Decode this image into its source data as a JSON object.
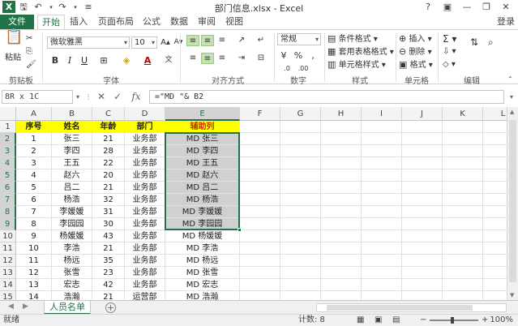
{
  "titlebar": {
    "title": "部门信息.xlsx - Excel",
    "logo": "X",
    "help": "?",
    "minimize": "—",
    "restore": "❐",
    "close": "✕"
  },
  "tabs": [
    "开始",
    "插入",
    "页面布局",
    "公式",
    "数据",
    "审阅",
    "视图"
  ],
  "file_tab": "文件",
  "login": "登录",
  "ribbon": {
    "paste": "粘贴",
    "clipboard_label": "剪贴板",
    "font_name": "微软雅黑",
    "font_size": "10",
    "font_label": "字体",
    "align_label": "对齐方式",
    "number_format": "常规",
    "number_label": "数字",
    "cond_format": "条件格式",
    "table_format": "套用表格格式",
    "cell_style": "单元格样式",
    "style_label": "样式",
    "insert": "插入",
    "delete": "删除",
    "format": "格式",
    "cells_label": "单元格",
    "edit_label": "编辑"
  },
  "formula_bar": {
    "name_box": "8R x 1C",
    "formula": "=\"MD \"& B2"
  },
  "columns": [
    "A",
    "B",
    "C",
    "D",
    "E",
    "F",
    "G",
    "H",
    "I",
    "J",
    "K",
    "L"
  ],
  "headers": [
    "序号",
    "姓名",
    "年龄",
    "部门",
    "辅助列"
  ],
  "rows": [
    [
      "1",
      "张三",
      "21",
      "业务部",
      "MD 张三"
    ],
    [
      "2",
      "李四",
      "28",
      "业务部",
      "MD 李四"
    ],
    [
      "3",
      "王五",
      "22",
      "业务部",
      "MD 王五"
    ],
    [
      "4",
      "赵六",
      "20",
      "业务部",
      "MD 赵六"
    ],
    [
      "5",
      "吕二",
      "21",
      "业务部",
      "MD 吕二"
    ],
    [
      "6",
      "杨浩",
      "32",
      "业务部",
      "MD 杨浩"
    ],
    [
      "7",
      "李媛媛",
      "31",
      "业务部",
      "MD 李媛媛"
    ],
    [
      "8",
      "李园园",
      "30",
      "业务部",
      "MD 李园园"
    ],
    [
      "9",
      "杨媛媛",
      "43",
      "业务部",
      "MD 杨媛媛"
    ],
    [
      "10",
      "李浩",
      "21",
      "业务部",
      "MD 李浩"
    ],
    [
      "11",
      "杨远",
      "35",
      "业务部",
      "MD 杨远"
    ],
    [
      "12",
      "张雪",
      "23",
      "业务部",
      "MD 张雪"
    ],
    [
      "13",
      "宏志",
      "42",
      "业务部",
      "MD 宏志"
    ],
    [
      "14",
      "浩瀚",
      "21",
      "运营部",
      "MD 浩瀚"
    ]
  ],
  "row_numbers": [
    "1",
    "2",
    "3",
    "4",
    "5",
    "6",
    "7",
    "8",
    "9",
    "10",
    "11",
    "12",
    "13",
    "14",
    "15"
  ],
  "sheet": {
    "name": "人员名单",
    "add": "+"
  },
  "status": {
    "ready": "就绪",
    "count": "计数: 8",
    "zoom": "100%"
  },
  "colors": {
    "accent": "#217346",
    "header_fill": "#ffff00",
    "header_red": "#e0201b"
  }
}
